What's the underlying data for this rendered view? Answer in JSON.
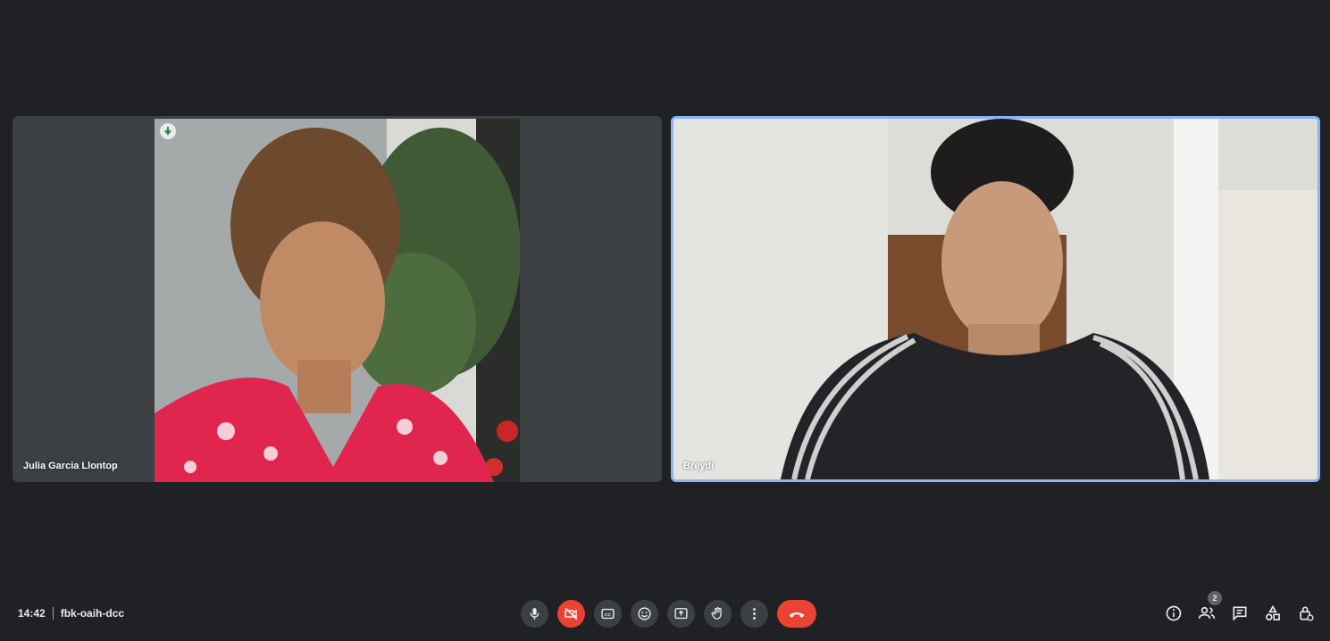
{
  "meeting": {
    "time": "14:42",
    "code": "fbk-oaih-dcc"
  },
  "participants": [
    {
      "name": "Julia Garcia Llontop"
    },
    {
      "name": "Breydi"
    }
  ],
  "people_count": "2",
  "controls": [
    "microphone-icon",
    "camera-off-icon",
    "captions-icon",
    "emoji-icon",
    "present-screen-icon",
    "raise-hand-icon",
    "more-options-icon",
    "hang-up-icon"
  ],
  "right_panel_icons": [
    "info-icon",
    "people-icon",
    "chat-icon",
    "activities-icon",
    "host-controls-icon"
  ],
  "colors": {
    "background": "#202124",
    "tile": "#3c4043",
    "active_speaker_border": "#8ab4f8",
    "danger": "#ea4335"
  }
}
